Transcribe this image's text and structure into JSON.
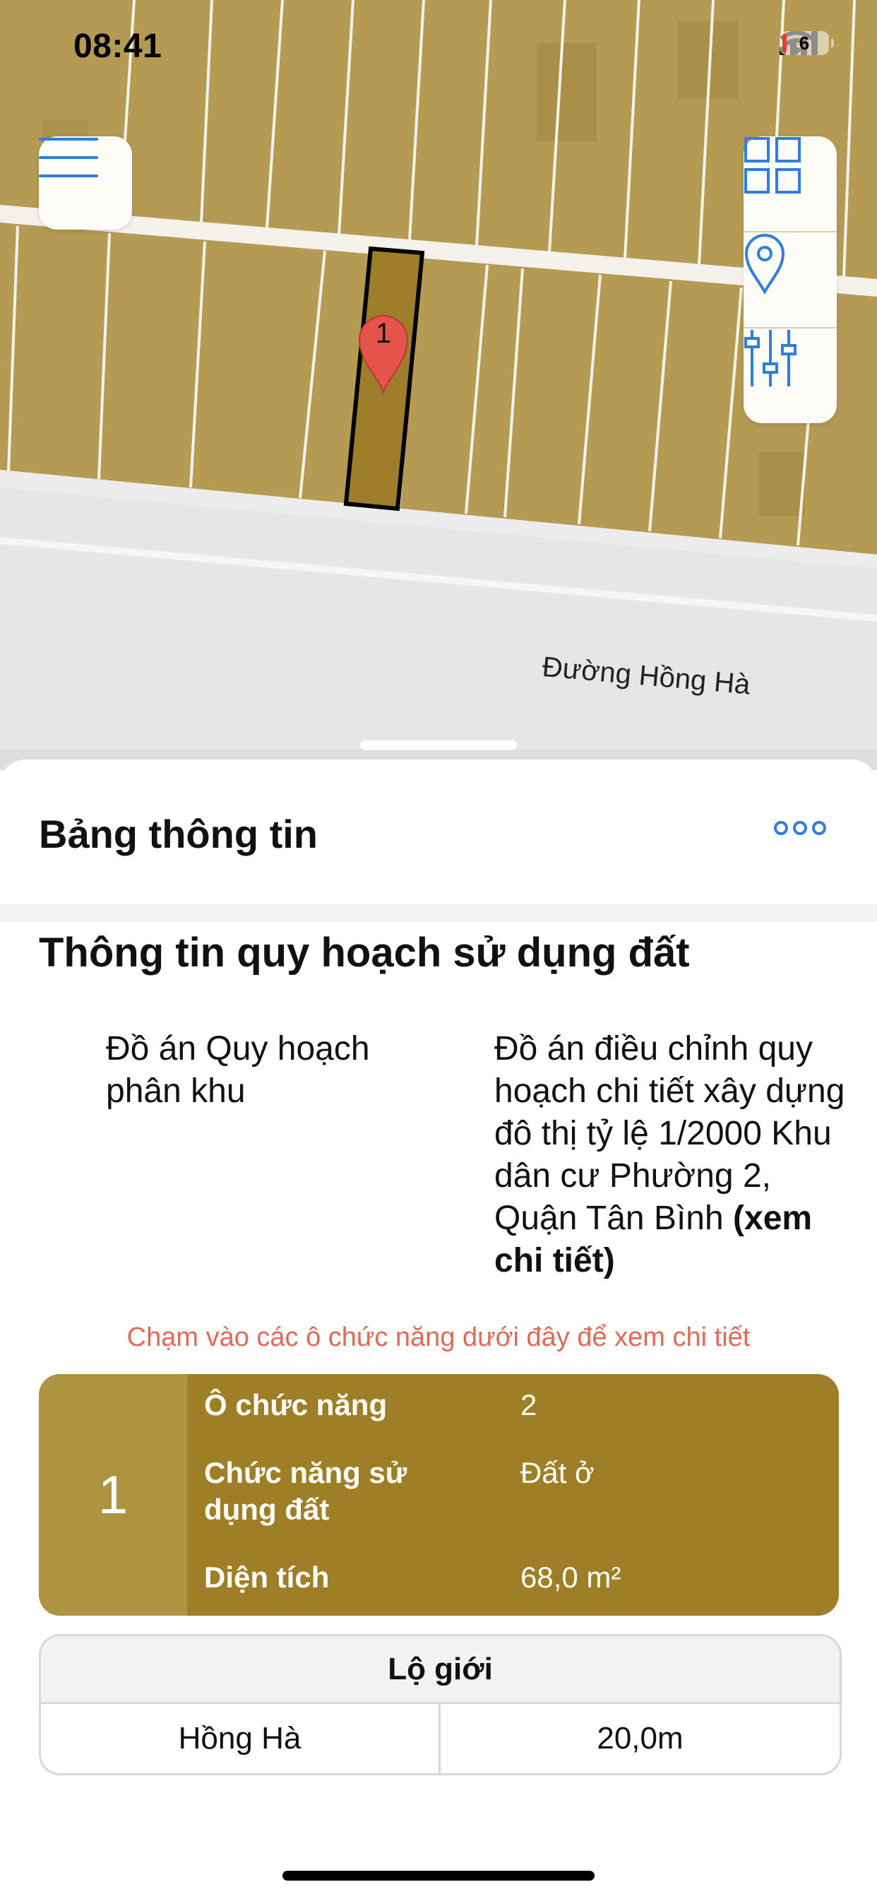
{
  "status_bar": {
    "time": "08:41",
    "battery_level": "6"
  },
  "map": {
    "road_label": "Đường Hồng Hà",
    "marker_label": "1",
    "colors": {
      "parcel_fill": "#b49a52",
      "selected_parcel": "#9d7f2b",
      "marker": "#e4544a",
      "road": "#e6e6e6"
    }
  },
  "map_controls": {
    "menu_icon": "hamburger-menu-icon",
    "tools": [
      "grid-layers-icon",
      "location-pin-icon",
      "sliders-filter-icon"
    ]
  },
  "sheet": {
    "title": "Bảng thông tin",
    "more_icon": "more-options-icon",
    "section_title": "Thông tin quy hoạch sử dụng đất",
    "plan_label": "Đồ án Quy hoạch phân khu",
    "plan_value": "Đồ án điều chỉnh quy hoạch chi tiết xây dựng đô thị tỷ lệ 1/2000 Khu dân cư Phường 2, Quận Tân Bình",
    "plan_link": "(xem chi tiết)",
    "hint": "Chạm vào các ô chức năng dưới đây để xem chi tiết",
    "function_card": {
      "number": "1",
      "rows": [
        {
          "label": "Ô chức năng",
          "value": "2"
        },
        {
          "label": "Chức năng sử dụng đất",
          "value": "Đất ở"
        },
        {
          "label": "Diện tích",
          "value": "68,0 m²"
        }
      ]
    },
    "road_boundary": {
      "header": "Lộ giới",
      "rows": [
        {
          "road": "Hồng Hà",
          "width": "20,0m"
        }
      ]
    }
  }
}
